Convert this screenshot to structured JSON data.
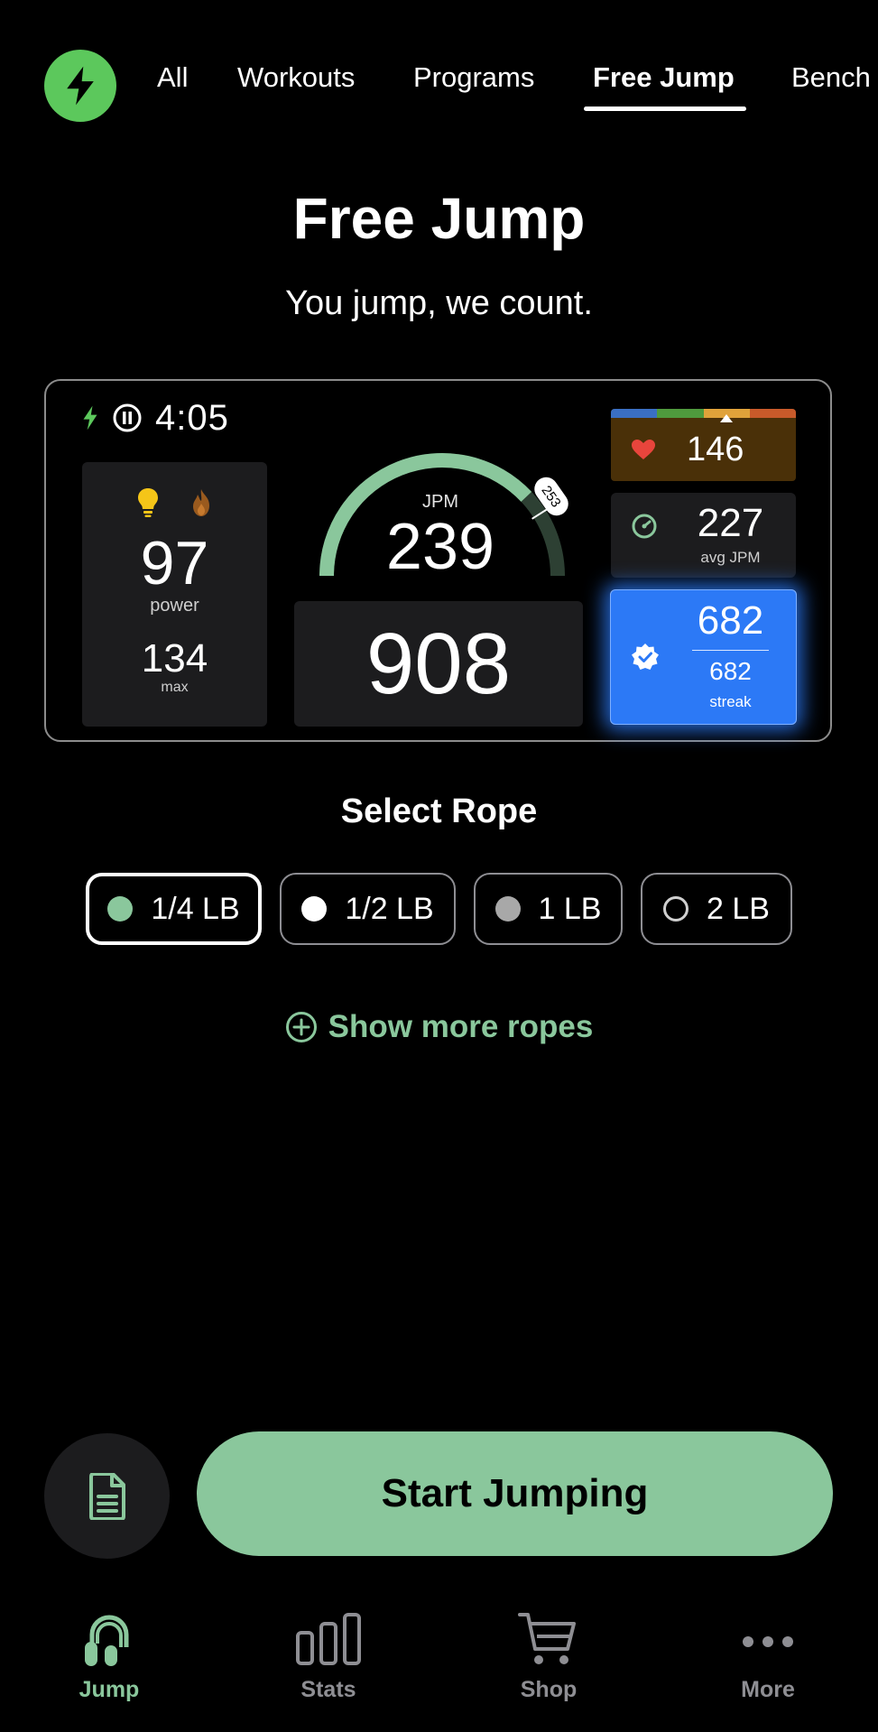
{
  "nav": {
    "tabs": [
      {
        "label": "All"
      },
      {
        "label": "Workouts"
      },
      {
        "label": "Programs"
      },
      {
        "label": "Free Jump",
        "active": true
      },
      {
        "label": "Bench"
      }
    ]
  },
  "header": {
    "title": "Free Jump",
    "subtitle": "You jump, we count."
  },
  "preview": {
    "timer": "4:05",
    "power_value": "97",
    "power_label": "power",
    "max_value": "134",
    "max_label": "max",
    "jpm_label": "JPM",
    "jpm_value": "239",
    "gauge_marker": "253",
    "gauge_fraction": 0.76,
    "jump_count": "908",
    "heart_rate": "146",
    "avg_jpm_value": "227",
    "avg_jpm_label": "avg JPM",
    "streak_value": "682",
    "streak_sub_value": "682",
    "streak_label": "streak",
    "colors": {
      "accent_green": "#8ac79c",
      "streak_blue": "#2c79f6",
      "heart_bg": "#4a3008",
      "zone_colors": [
        "#3a6fc4",
        "#4f9a3d",
        "#e0a23a",
        "#c85a2a"
      ]
    }
  },
  "ropes": {
    "title": "Select Rope",
    "options": [
      {
        "label": "1/4 LB",
        "dot": "green",
        "selected": true
      },
      {
        "label": "1/2 LB",
        "dot": "white"
      },
      {
        "label": "1 LB",
        "dot": "gray"
      },
      {
        "label": "2 LB",
        "dot": "outline"
      }
    ],
    "show_more": "Show more ropes"
  },
  "actions": {
    "start_label": "Start Jumping"
  },
  "bottom_nav": [
    {
      "label": "Jump",
      "icon": "rope-icon",
      "active": true
    },
    {
      "label": "Stats",
      "icon": "stats-icon"
    },
    {
      "label": "Shop",
      "icon": "cart-icon"
    },
    {
      "label": "More",
      "icon": "more-icon"
    }
  ]
}
